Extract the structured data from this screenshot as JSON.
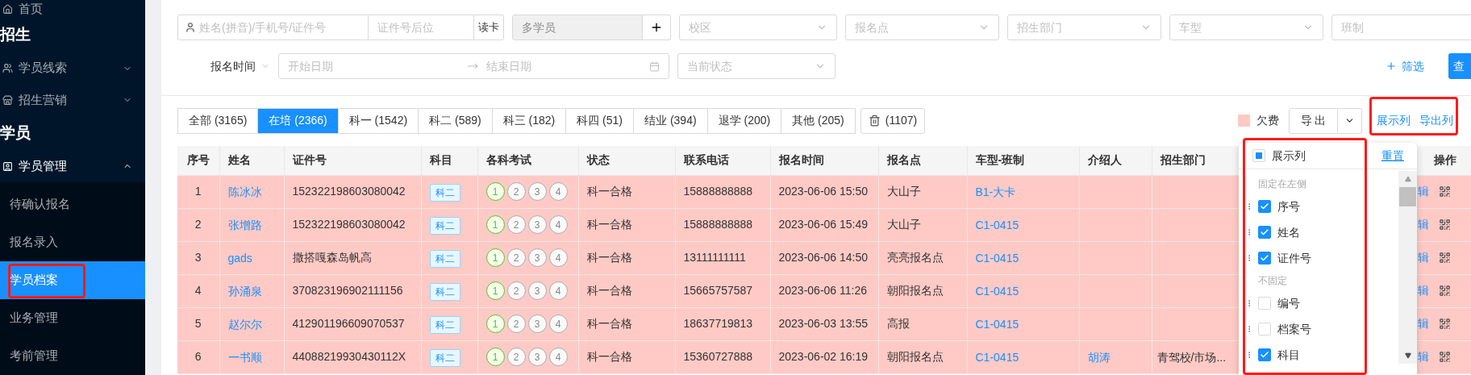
{
  "sidebar": {
    "items": [
      {
        "kind": "link",
        "label": "首页"
      },
      {
        "kind": "section",
        "label": "招生"
      },
      {
        "kind": "menu",
        "label": "学员线索",
        "expanded": false
      },
      {
        "kind": "menu",
        "label": "招生营销",
        "expanded": false
      },
      {
        "kind": "section",
        "label": "学员"
      },
      {
        "kind": "menu",
        "label": "学员管理",
        "expanded": true,
        "children": [
          {
            "label": "待确认报名",
            "selected": false
          },
          {
            "label": "报名录入",
            "selected": false
          },
          {
            "label": "学员档案",
            "selected": true
          },
          {
            "label": "业务管理",
            "selected": false
          },
          {
            "label": "考前管理",
            "selected": false
          }
        ]
      }
    ]
  },
  "filters": {
    "name_field": {
      "placeholder": "姓名(拼音)/手机号/证件号"
    },
    "id_suffix_field": {
      "placeholder": "证件号后位"
    },
    "read_card_button": "读卡",
    "multi_student_field": {
      "placeholder": "多学员",
      "disabled": true
    },
    "selects": [
      {
        "placeholder": "校区"
      },
      {
        "placeholder": "报名点"
      },
      {
        "placeholder": "招生部门"
      },
      {
        "placeholder": "车型"
      },
      {
        "placeholder": "班制"
      }
    ],
    "date_type": "报名时间",
    "date_range": {
      "start_placeholder": "开始日期",
      "end_placeholder": "结束日期"
    },
    "status_select": {
      "placeholder": "当前状态"
    },
    "filter_link": "筛选",
    "query_button": "查"
  },
  "tabs": [
    {
      "label": "全部 (3165)",
      "selected": false
    },
    {
      "label": "在培 (2366)",
      "selected": true
    },
    {
      "label": "科一 (1542)",
      "selected": false
    },
    {
      "label": "科二 (589)",
      "selected": false
    },
    {
      "label": "科三 (182)",
      "selected": false
    },
    {
      "label": "科四 (51)",
      "selected": false
    },
    {
      "label": "结业 (394)",
      "selected": false
    },
    {
      "label": "退学 (200)",
      "selected": false
    },
    {
      "label": "其他 (205)",
      "selected": false
    }
  ],
  "trash_tab": {
    "count": "(1107)"
  },
  "legend": {
    "label": "欠费"
  },
  "export_button": "导 出",
  "column_links": [
    "展示列",
    "导出列"
  ],
  "table": {
    "columns": [
      "序号",
      "姓名",
      "证件号",
      "科目",
      "各科考试",
      "状态",
      "联系电话",
      "报名时间",
      "报名点",
      "车型-班制",
      "介绍人",
      "招生部门",
      "操作"
    ],
    "rows": [
      {
        "index": "1",
        "name": "陈冰冰",
        "id_number": "152322198603080042",
        "subject": "科二",
        "exams": [
          {
            "label": "1",
            "passed": true
          },
          {
            "label": "2",
            "passed": false
          },
          {
            "label": "3",
            "passed": false
          },
          {
            "label": "4",
            "passed": false
          }
        ],
        "status": "科一合格",
        "phone": "15888888888",
        "signup_time": "2023-06-06 15:50",
        "signup_point": "大山子",
        "class": "B1-大卡",
        "action": "辑",
        "arrears": true
      },
      {
        "index": "2",
        "name": "张增路",
        "id_number": "152322198603080042",
        "subject": "科二",
        "exams": [
          {
            "label": "1",
            "passed": true
          },
          {
            "label": "2",
            "passed": false
          },
          {
            "label": "3",
            "passed": false
          },
          {
            "label": "4",
            "passed": false
          }
        ],
        "status": "科一合格",
        "phone": "15888888888",
        "signup_time": "2023-06-06 15:49",
        "signup_point": "大山子",
        "class": "C1-0415",
        "action": "辑",
        "arrears": true
      },
      {
        "index": "3",
        "name": "gads",
        "id_number": "撒搭嘎森岛帆高",
        "subject": "科二",
        "exams": [
          {
            "label": "1",
            "passed": true
          },
          {
            "label": "2",
            "passed": false
          },
          {
            "label": "3",
            "passed": false
          },
          {
            "label": "4",
            "passed": false
          }
        ],
        "status": "科一合格",
        "phone": "13111111111",
        "signup_time": "2023-06-06 14:50",
        "signup_point": "亮亮报名点",
        "class": "C1-0415",
        "action": "辑",
        "arrears": true
      },
      {
        "index": "4",
        "name": "孙涌泉",
        "id_number": "370823196902111156",
        "subject": "科二",
        "exams": [
          {
            "label": "1",
            "passed": true
          },
          {
            "label": "2",
            "passed": false
          },
          {
            "label": "3",
            "passed": false
          },
          {
            "label": "4",
            "passed": false
          }
        ],
        "status": "科一合格",
        "phone": "15665757587",
        "signup_time": "2023-06-06 11:26",
        "signup_point": "朝阳报名点",
        "class": "C1-0415",
        "action": "辑",
        "arrears": true
      },
      {
        "index": "5",
        "name": "赵尔尔",
        "id_number": "412901196609070537",
        "subject": "科二",
        "exams": [
          {
            "label": "1",
            "passed": true
          },
          {
            "label": "2",
            "passed": false
          },
          {
            "label": "3",
            "passed": false
          },
          {
            "label": "4",
            "passed": false
          }
        ],
        "status": "科一合格",
        "phone": "18637719813",
        "signup_time": "2023-06-03 13:55",
        "signup_point": "高报",
        "class": "C1-0415",
        "action": "辑",
        "arrears": true
      },
      {
        "index": "6",
        "name": "一书顺",
        "id_number": "44088219930430112X",
        "subject": "科二",
        "exams": [
          {
            "label": "1",
            "passed": true
          },
          {
            "label": "2",
            "passed": false
          },
          {
            "label": "3",
            "passed": false
          },
          {
            "label": "4",
            "passed": false
          }
        ],
        "status": "科一合格",
        "phone": "15360727888",
        "signup_time": "2023-06-02 16:19",
        "signup_point": "朝阳报名点",
        "class": "C1-0415",
        "referrer": "胡涛",
        "dept": "青驾校/市场...",
        "action": "辑",
        "arrears": true
      }
    ]
  },
  "column_popup": {
    "title": "展示列",
    "indeterminate": true,
    "reset": "重置",
    "groups": [
      {
        "label": "固定在左侧",
        "items": [
          {
            "label": "序号",
            "checked": true
          },
          {
            "label": "姓名",
            "checked": true
          },
          {
            "label": "证件号",
            "checked": true
          }
        ]
      },
      {
        "label": "不固定",
        "items": [
          {
            "label": "编号",
            "checked": false
          },
          {
            "label": "档案号",
            "checked": false
          },
          {
            "label": "科目",
            "checked": true
          }
        ]
      }
    ]
  }
}
